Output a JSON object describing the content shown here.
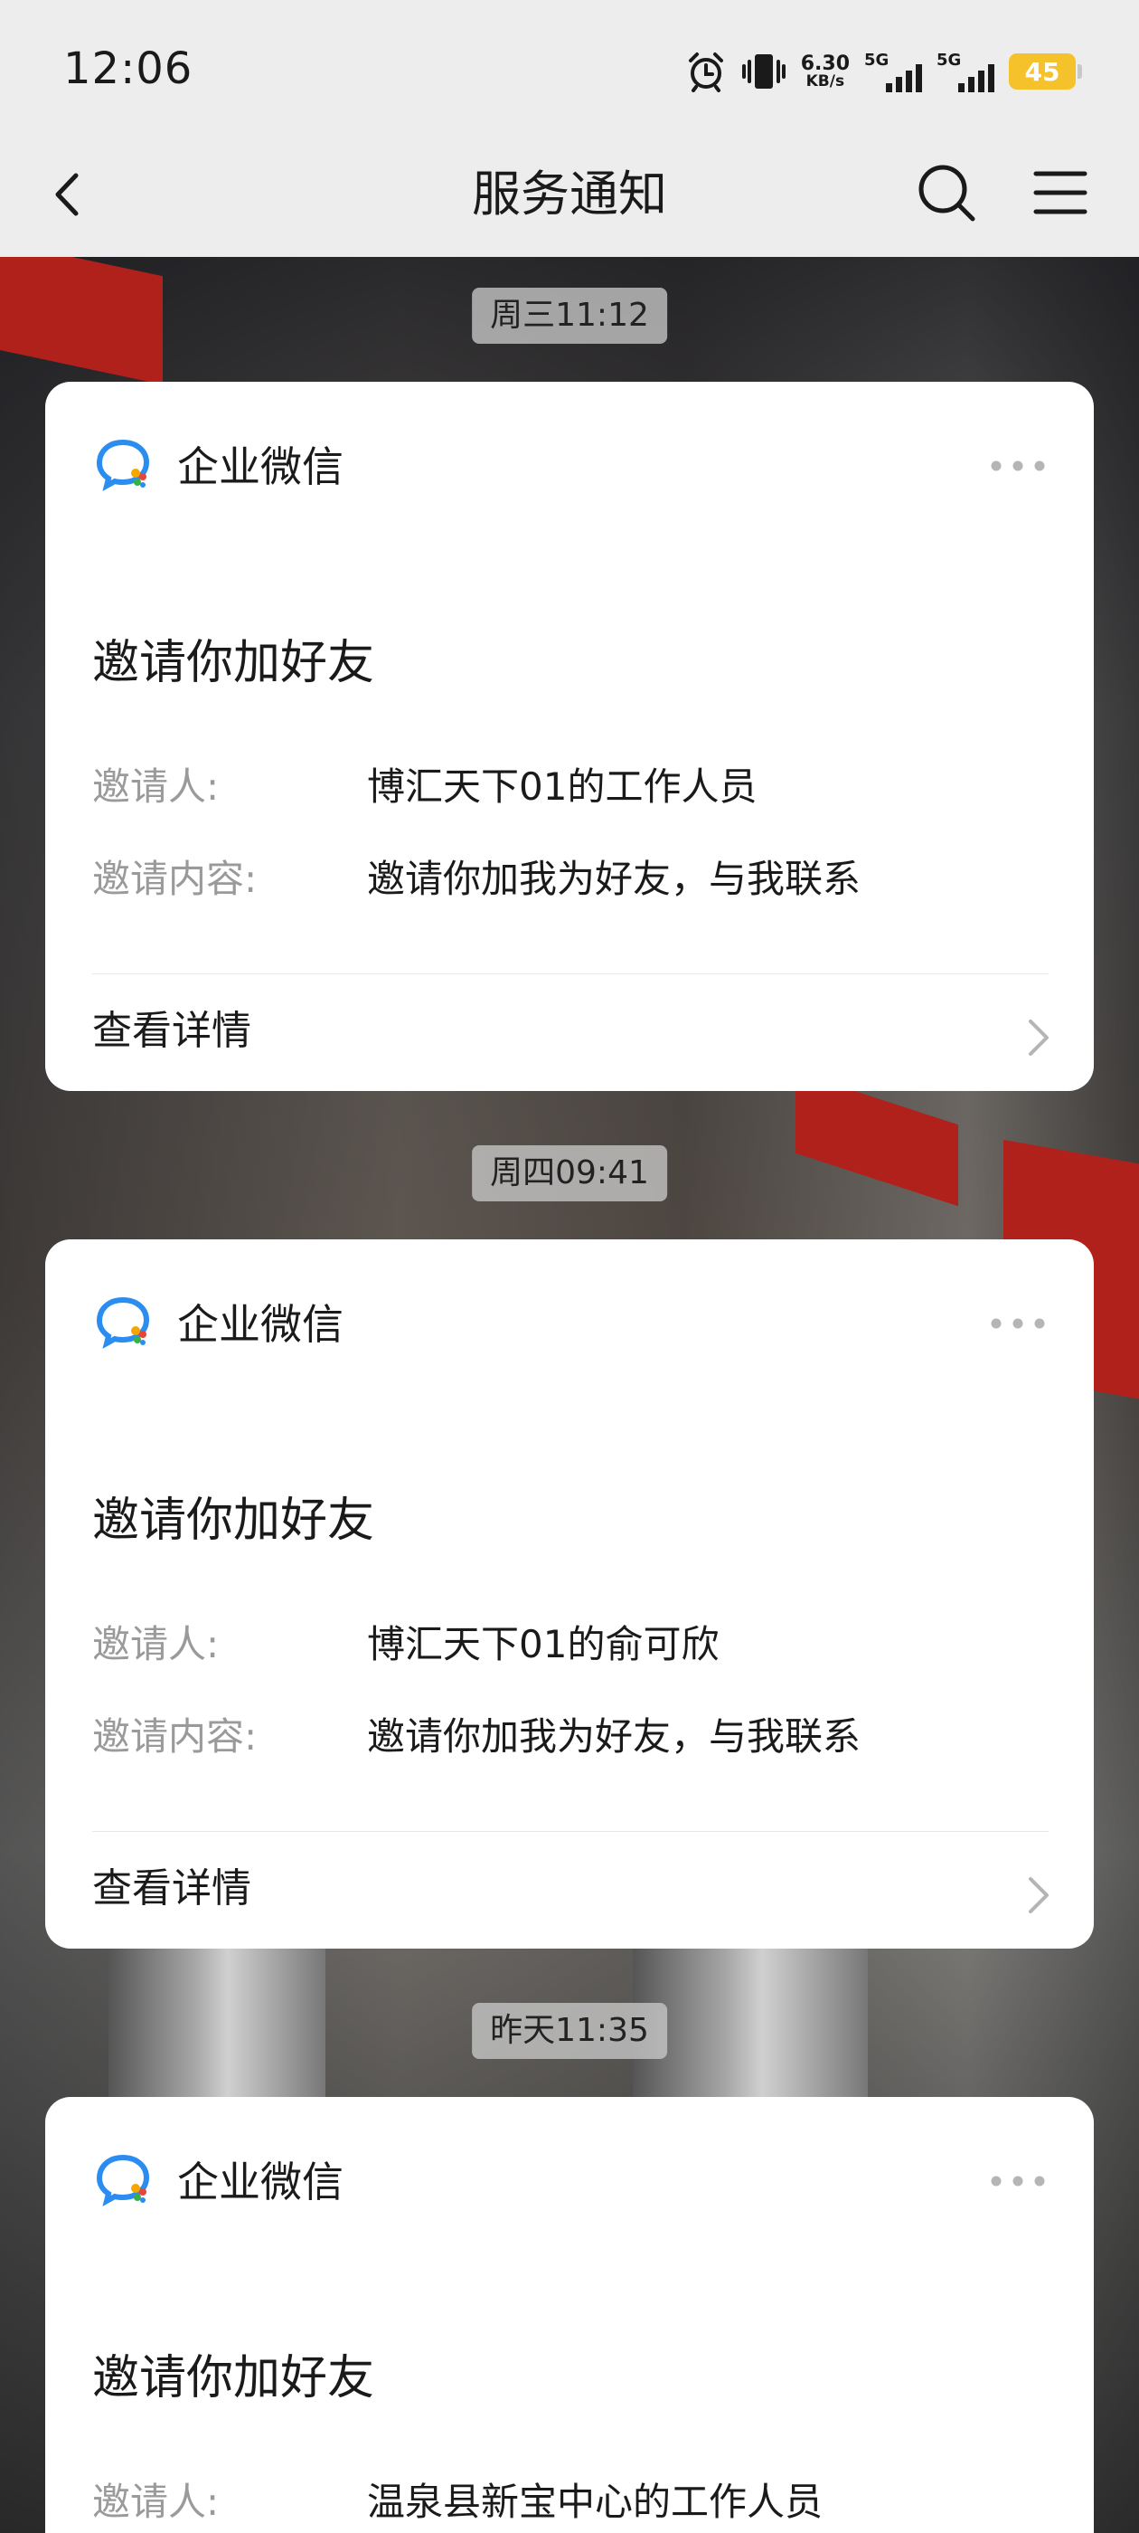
{
  "status_bar": {
    "time": "12:06",
    "net_speed_value": "6.30",
    "net_speed_unit": "KB/s",
    "signal1_label": "5G",
    "signal2_label": "5G",
    "battery": "45",
    "battery_color": "#f5c22b"
  },
  "header": {
    "title": "服务通知",
    "back_icon": "back-arrow-icon",
    "search_icon": "search-icon",
    "menu_icon": "menu-icon"
  },
  "messages": [
    {
      "timestamp": "周三11:12",
      "app_name": "企业微信",
      "title": "邀请你加好友",
      "inviter_label": "邀请人:",
      "inviter_value": "博汇天下01的工作人员",
      "content_label": "邀请内容:",
      "content_value": "邀请你加我为好友，与我联系",
      "detail_label": "查看详情"
    },
    {
      "timestamp": "周四09:41",
      "app_name": "企业微信",
      "title": "邀请你加好友",
      "inviter_label": "邀请人:",
      "inviter_value": "博汇天下01的俞可欣",
      "content_label": "邀请内容:",
      "content_value": "邀请你加我为好友，与我联系",
      "detail_label": "查看详情"
    },
    {
      "timestamp": "昨天11:35",
      "app_name": "企业微信",
      "title": "邀请你加好友",
      "inviter_label": "邀请人:",
      "inviter_value": "温泉县新宝中心的工作人员"
    }
  ]
}
